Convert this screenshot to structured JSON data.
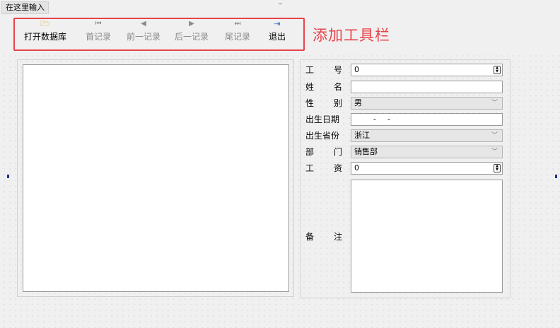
{
  "menubar": {
    "placeholder": "在这里输入"
  },
  "toolbar": {
    "buttons": [
      {
        "label": "打开数据库",
        "icon": "open-folder-icon",
        "glyph": "🗁",
        "enabled": true
      },
      {
        "label": "首记录",
        "icon": "first-record-icon",
        "glyph": "⏮",
        "enabled": false
      },
      {
        "label": "前一记录",
        "icon": "previous-record-icon",
        "glyph": "◀",
        "enabled": false
      },
      {
        "label": "后一记录",
        "icon": "next-record-icon",
        "glyph": "▶",
        "enabled": false
      },
      {
        "label": "尾记录",
        "icon": "last-record-icon",
        "glyph": "⏭",
        "enabled": false
      },
      {
        "label": "退出",
        "icon": "exit-icon",
        "glyph": "⇥",
        "enabled": true
      }
    ]
  },
  "annotation": {
    "text": "添加工具栏",
    "color": "#e8434b"
  },
  "form": {
    "labels": {
      "employee_id": [
        "工",
        "号"
      ],
      "name": [
        "姓",
        "名"
      ],
      "gender": [
        "性",
        "别"
      ],
      "birth_date": "出生日期",
      "birth_province": "出生省份",
      "department": [
        "部",
        "门"
      ],
      "salary": [
        "工",
        "资"
      ],
      "remark": [
        "备",
        "注"
      ]
    },
    "values": {
      "employee_id": "0",
      "name": "",
      "gender": "男",
      "birth_date_sep": "-",
      "birth_province": "浙江",
      "department": "销售部",
      "salary": "0",
      "remark": ""
    },
    "glyphs": {
      "combo_arrow": "﹀",
      "spin_up": "▲",
      "spin_down": "▼"
    }
  }
}
